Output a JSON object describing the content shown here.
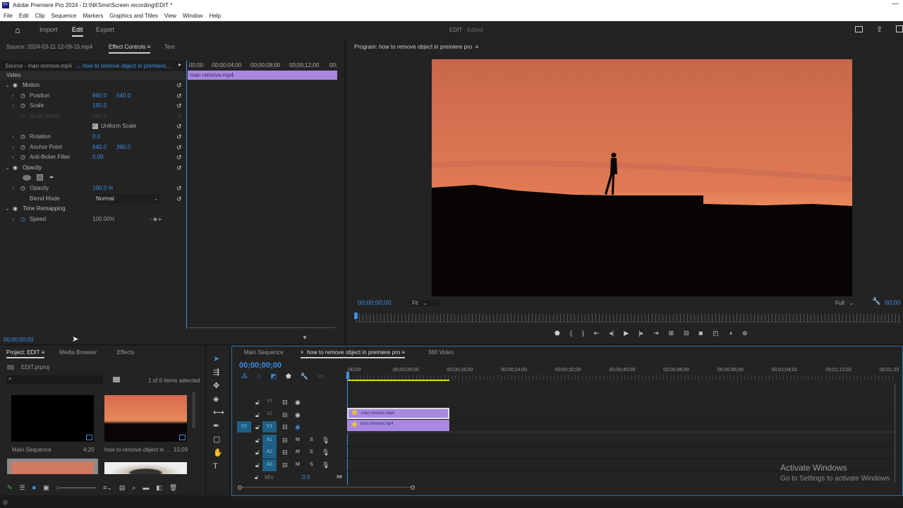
{
  "window": {
    "title": "Adobe Premiere Pro 2024 - D:\\NKSme\\Screen recording\\EDIT *",
    "logo": "Pr"
  },
  "menu": [
    "File",
    "Edit",
    "Clip",
    "Sequence",
    "Markers",
    "Graphics and Titles",
    "View",
    "Window",
    "Help"
  ],
  "header": {
    "nav": [
      "Import",
      "Edit",
      "Export"
    ],
    "status": "EDIT",
    "edited": "- Edited"
  },
  "effect_controls": {
    "tabs": [
      "Source: 2024-03-11 12-09-15.mp4",
      "Effect Controls",
      "Text"
    ],
    "source": "Source - man remove.mp4",
    "sequence": "how to remove object in premiere...",
    "ruler": [
      "00;00",
      "00;00;04;00",
      "00;00;08;00",
      "00;00;12;00",
      "00;"
    ],
    "clip": "man remove.mp4",
    "section": "Video",
    "rows": [
      {
        "label": "Motion",
        "type": "group"
      },
      {
        "label": "Position",
        "v1": "960.0",
        "v2": "540.0"
      },
      {
        "label": "Scale",
        "v1": "150.0"
      },
      {
        "label": "Scale Width",
        "v1": "100.0",
        "disabled": true
      },
      {
        "label": "Uniform Scale",
        "type": "check"
      },
      {
        "label": "Rotation",
        "v1": "0.0"
      },
      {
        "label": "Anchor Point",
        "v1": "640.0",
        "v2": "360.0"
      },
      {
        "label": "Anti-flicker Filter",
        "v1": "0.00"
      },
      {
        "label": "Opacity",
        "type": "group"
      },
      {
        "label": "",
        "type": "masks"
      },
      {
        "label": "Opacity",
        "v1": "100.0 %"
      },
      {
        "label": "Blend Mode",
        "type": "select",
        "v1": "Normal"
      },
      {
        "label": "Time Remapping",
        "type": "group"
      },
      {
        "label": "Speed",
        "v1": "100.00%",
        "white": true
      }
    ],
    "timecode": "00;00;00;00"
  },
  "program": {
    "title": "Program: how to remove object in premiere pro",
    "timecode": "00;00;00;00",
    "fit": "Fit",
    "quality": "Full",
    "end_timecode": "00;00"
  },
  "project": {
    "tabs": [
      "Project: EDIT",
      "Media Browser",
      "Effects"
    ],
    "file": "EDIT.prproj",
    "selection": "1 of 6 items selected",
    "items": [
      {
        "name": "Main Sequence",
        "duration": "4:20"
      },
      {
        "name": "how to remove object in ...",
        "duration": "15;09"
      }
    ]
  },
  "timeline": {
    "tabs": [
      "Main Sequence",
      "how to remove object in premiere pro",
      "360 Video"
    ],
    "timecode": "00;00;00;00",
    "ruler": [
      ";00;00",
      "00;00;08;00",
      "00;00;16;00",
      "00;00;24;00",
      "00;00;32;00",
      "00;00;40;00",
      "00;00;48;00",
      "00;00;56;00",
      "00;01;04;02",
      "00;01;12;02",
      "00;01;20"
    ],
    "video_tracks": [
      "V3",
      "V2",
      "V1"
    ],
    "audio_tracks": [
      "A1",
      "A2",
      "A3"
    ],
    "source_v": "V1",
    "mix": "Mix",
    "mix_value": "0.0",
    "clips": [
      {
        "track": "V2",
        "name": "man remove.mp4"
      },
      {
        "track": "V1",
        "name": "man remove.mp4"
      }
    ],
    "m": "M",
    "s": "S"
  },
  "watermark": {
    "title": "Activate Windows",
    "subtitle": "Go to Settings to activate Windows"
  }
}
